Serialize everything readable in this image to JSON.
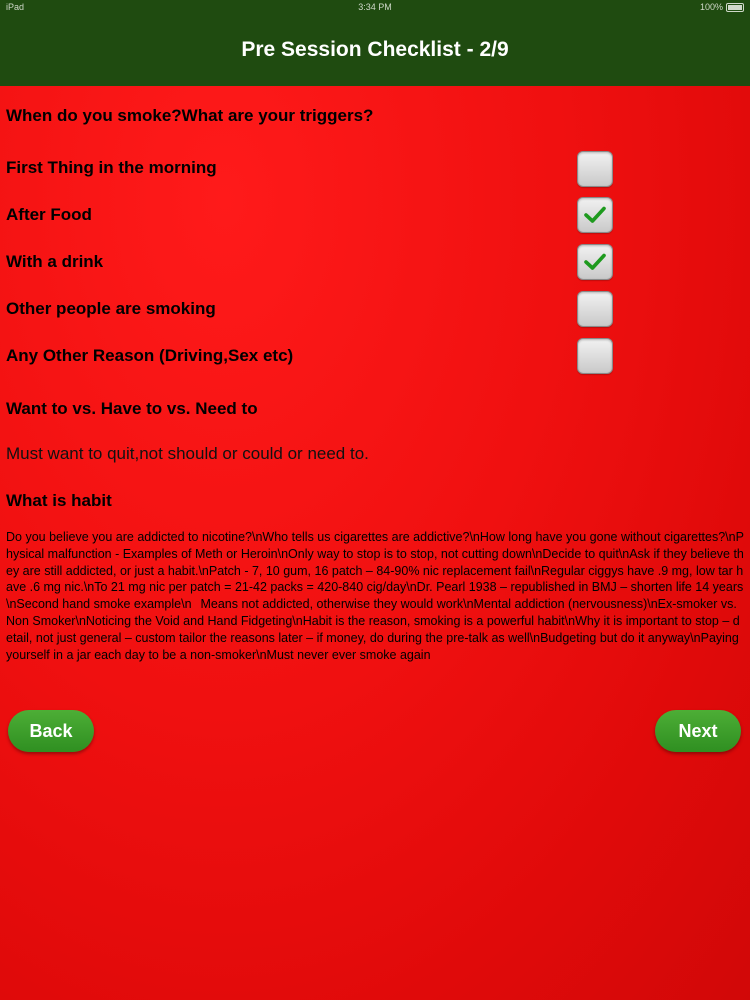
{
  "status_bar": {
    "carrier": "iPad",
    "time": "3:34 PM",
    "battery": "100%"
  },
  "header": {
    "title": "Pre Session Checklist - 2/9"
  },
  "triggers": {
    "heading": "When do you smoke?What are your triggers?",
    "items": [
      {
        "label": "First Thing in the morning",
        "checked": false
      },
      {
        "label": "After Food",
        "checked": true
      },
      {
        "label": "With a drink",
        "checked": true
      },
      {
        "label": "Other people are smoking",
        "checked": false
      },
      {
        "label": "Any Other Reason (Driving,Sex etc)",
        "checked": false
      }
    ]
  },
  "want_section": {
    "heading": "Want to vs. Have to vs. Need to",
    "text": "Must want to quit,not should or could or need to."
  },
  "habit_section": {
    "heading": "What is habit",
    "body": "Do you believe you are addicted to nicotine?\\nWho tells us cigarettes are addictive?\\nHow long have you gone without cigarettes?\\nPhysical malfunction - Examples of Meth or Heroin\\nOnly way to stop is to stop, not cutting down\\nDecide to quit\\nAsk if they believe they are still addicted, or just a habit.\\nPatch - 7, 10 gum, 16 patch – 84-90% nic replacement fail\\nRegular ciggys have .9 mg, low tar have .6 mg nic.\\nTo 21 mg nic per patch = 21-42 packs = 420-840 cig/day\\nDr. Pearl 1938 – republished in BMJ – shorten life 14 years\\nSecond hand smoke example\\n\tMeans not addicted, otherwise they would work\\nMental addiction (nervousness)\\nEx-smoker vs. Non Smoker\\nNoticing the Void and Hand Fidgeting\\nHabit is the reason, smoking is a powerful habit\\nWhy it is important to stop – detail, not just general – custom tailor the reasons later – if money, do during the pre-talk as well\\nBudgeting but do it anyway\\nPaying yourself in a jar each day to be a non-smoker\\nMust never ever smoke again"
  },
  "buttons": {
    "back": "Back",
    "next": "Next"
  },
  "colors": {
    "nav_bar": "#1f4b10",
    "background": "#f01010",
    "button_green": "#3a9c28",
    "check_green": "#1e9a1e"
  }
}
